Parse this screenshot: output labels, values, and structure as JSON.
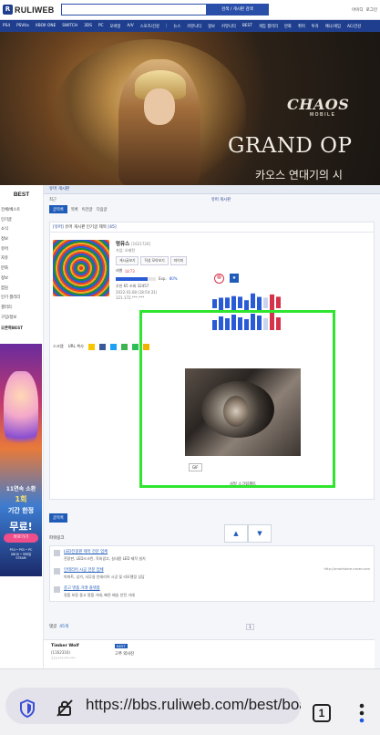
{
  "header": {
    "logo_text": "RULIWEB",
    "search_placeholder": "",
    "search_button": "검색 / 게시판 검색",
    "top_right": [
      "아이디",
      "로그인"
    ]
  },
  "nav": [
    "PS4",
    "PSVita",
    "XBOX ONE",
    "SWITCH",
    "3DS",
    "PC",
    "모바일",
    "A/V",
    "스포츠/건강",
    "|",
    "뉴스",
    "커뮤니티",
    "정보",
    "커뮤니티",
    "BEST",
    "게임 갤러리",
    "만화",
    "취미",
    "투자",
    "애니/게임",
    "AC/건강"
  ],
  "banner": {
    "logo": "CHAOS",
    "logo_sub": "MOBILE",
    "title": "GRAND OP",
    "subtitle": "카오스 연대기의 시"
  },
  "sidebar": {
    "title": "BEST",
    "items": [
      "전체/베스트",
      "인기글",
      "소식",
      "정보",
      "유머",
      "자유",
      "만화",
      "정보",
      "잡담",
      "인기 갤러리",
      "갤러리",
      "구입/정보"
    ],
    "section": "오른쪽BEST",
    "ad": {
      "line1": "11연속 소환",
      "line2": "1회",
      "line3": "기간 한정",
      "line4": "무료!",
      "button": "바로가기",
      "platforms": "PS4 • PS5 • PC\nXBOX • 모바일\nSTEAM"
    }
  },
  "board": {
    "head": "유머 게시판",
    "sub_left": "최근",
    "sub_right": "유머 게시판",
    "tabs": [
      "글목록",
      "목록",
      "이전글",
      "다음글"
    ]
  },
  "post": {
    "category": "[유머]",
    "title": "유머 게시판 인기글 제목",
    "comment_count": "[45]",
    "author": "멍유스",
    "uid": "[1621726]",
    "join": "가입: 오래전",
    "buttons": [
      "게시글보기",
      "작성 모아보기",
      "마이피"
    ],
    "points_label": "레벨",
    "level": "LV.73",
    "exp_label": "Exp.",
    "exp_pct": "80%",
    "exp_fraction": 0.8,
    "stats": "추천 65  조회 32457",
    "date": "2022.03.08 (18:54:31)",
    "ip": "121.172.***.***",
    "actions": [
      "스크랩",
      "URL 복사"
    ],
    "gif_tag": "GIF",
    "caption": "사일 스크림제트",
    "vote_up": "▲",
    "vote_down": "▼"
  },
  "activity_bars": [
    {
      "h": 0.55,
      "c": "#2a5bd7"
    },
    {
      "h": 0.75,
      "c": "#2a5bd7"
    },
    {
      "h": 0.65,
      "c": "#2a5bd7"
    },
    {
      "h": 0.85,
      "c": "#2a5bd7"
    },
    {
      "h": 0.7,
      "c": "#2a5bd7"
    },
    {
      "h": 0.6,
      "c": "#2a5bd7"
    },
    {
      "h": 0.9,
      "c": "#2a5bd7"
    },
    {
      "h": 0.8,
      "c": "#2a5bd7"
    },
    {
      "h": 0.65,
      "c": "#c9d5ee"
    },
    {
      "h": 0.95,
      "c": "#d6334a"
    },
    {
      "h": 0.7,
      "c": "#d6334a"
    }
  ],
  "list_button": "글목록",
  "links": {
    "head": "파워링크",
    "items": [
      {
        "title": "LED전광판 제작 전문 업체",
        "desc": "전광판, LED스크린, 옥외광고, 실내용 LED 제작 설치",
        "url": ""
      },
      {
        "title": "인테리어 시공 전문 업체",
        "desc": "아파트, 상가, 사무실 인테리어 시공 및 리모델링 상담",
        "url": "http://smartstore.naver.com"
      },
      {
        "title": "중고 명품 거래 플랫폼",
        "desc": "정품 보증 중고 명품 거래, 빠른 배송 안전 거래",
        "url": ""
      }
    ]
  },
  "comments": {
    "label": "댓글",
    "count": "45개",
    "page": "1",
    "first": {
      "author": "Timber Wolf",
      "id": "(1162316)",
      "date": "172.***.***.***",
      "badge": "BEST",
      "text": "고추 외사진"
    },
    "second_badge": "BEST"
  },
  "browser": {
    "url": "https://bbs.ruliweb.com/best/board",
    "tab_count": "1"
  }
}
